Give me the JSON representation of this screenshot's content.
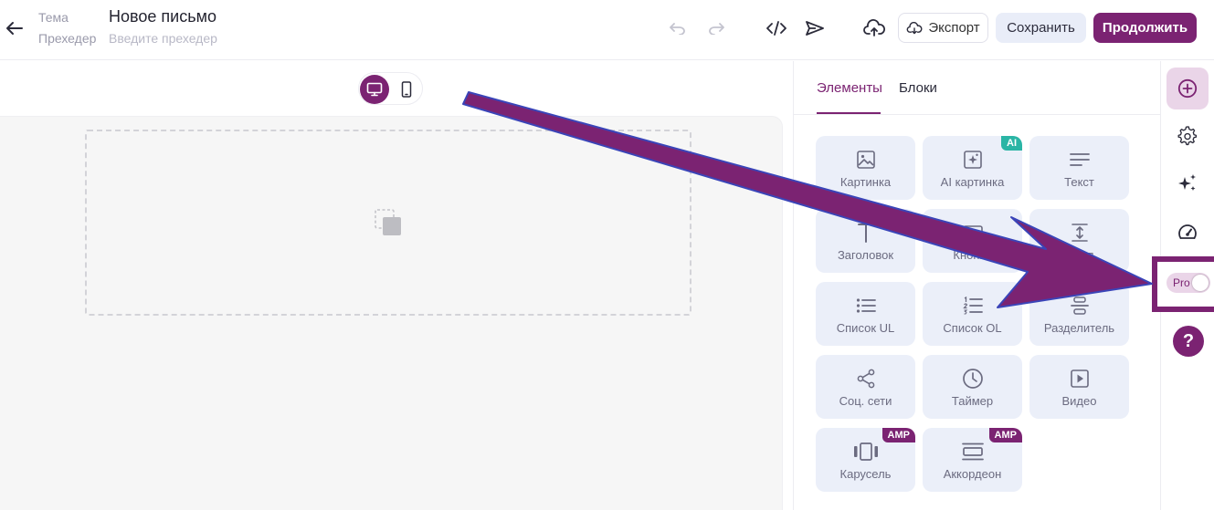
{
  "header": {
    "subject_label": "Тема",
    "preheader_label": "Прехедер",
    "title": "Новое письмо",
    "preheader_placeholder": "Введите прехедер",
    "export_label": "Экспорт",
    "save_label": "Сохранить",
    "continue_label": "Продолжить"
  },
  "panel": {
    "tabs": [
      {
        "label": "Элементы",
        "active": true
      },
      {
        "label": "Блоки",
        "active": false
      }
    ],
    "elements": [
      {
        "label": "Картинка",
        "icon": "image-icon"
      },
      {
        "label": "AI картинка",
        "icon": "ai-image-icon",
        "badge": "AI"
      },
      {
        "label": "Текст",
        "icon": "text-lines-icon"
      },
      {
        "label": "Заголовок",
        "icon": "heading-icon"
      },
      {
        "label": "Кнопка",
        "icon": "button-icon"
      },
      {
        "label": "Отступ",
        "visible_label": "тступ",
        "icon": "spacer-icon"
      },
      {
        "label": "Список UL",
        "icon": "bullet-list-icon"
      },
      {
        "label": "Список OL",
        "icon": "numbered-list-icon"
      },
      {
        "label": "Разделитель",
        "icon": "divider-icon"
      },
      {
        "label": "Соц. сети",
        "icon": "share-icon"
      },
      {
        "label": "Таймер",
        "icon": "clock-icon"
      },
      {
        "label": "Видео",
        "icon": "video-icon"
      },
      {
        "label": "Карусель",
        "icon": "carousel-icon",
        "badge": "AMP"
      },
      {
        "label": "Аккордеон",
        "icon": "accordion-icon",
        "badge": "AMP"
      }
    ]
  },
  "rail": {
    "pro_label": "Pro",
    "help_label": "?"
  },
  "colors": {
    "brand": "#7b2372",
    "brand_light": "#ead5e8",
    "tile_bg": "#ebeff9",
    "ai_badge": "#2ab5a5"
  }
}
